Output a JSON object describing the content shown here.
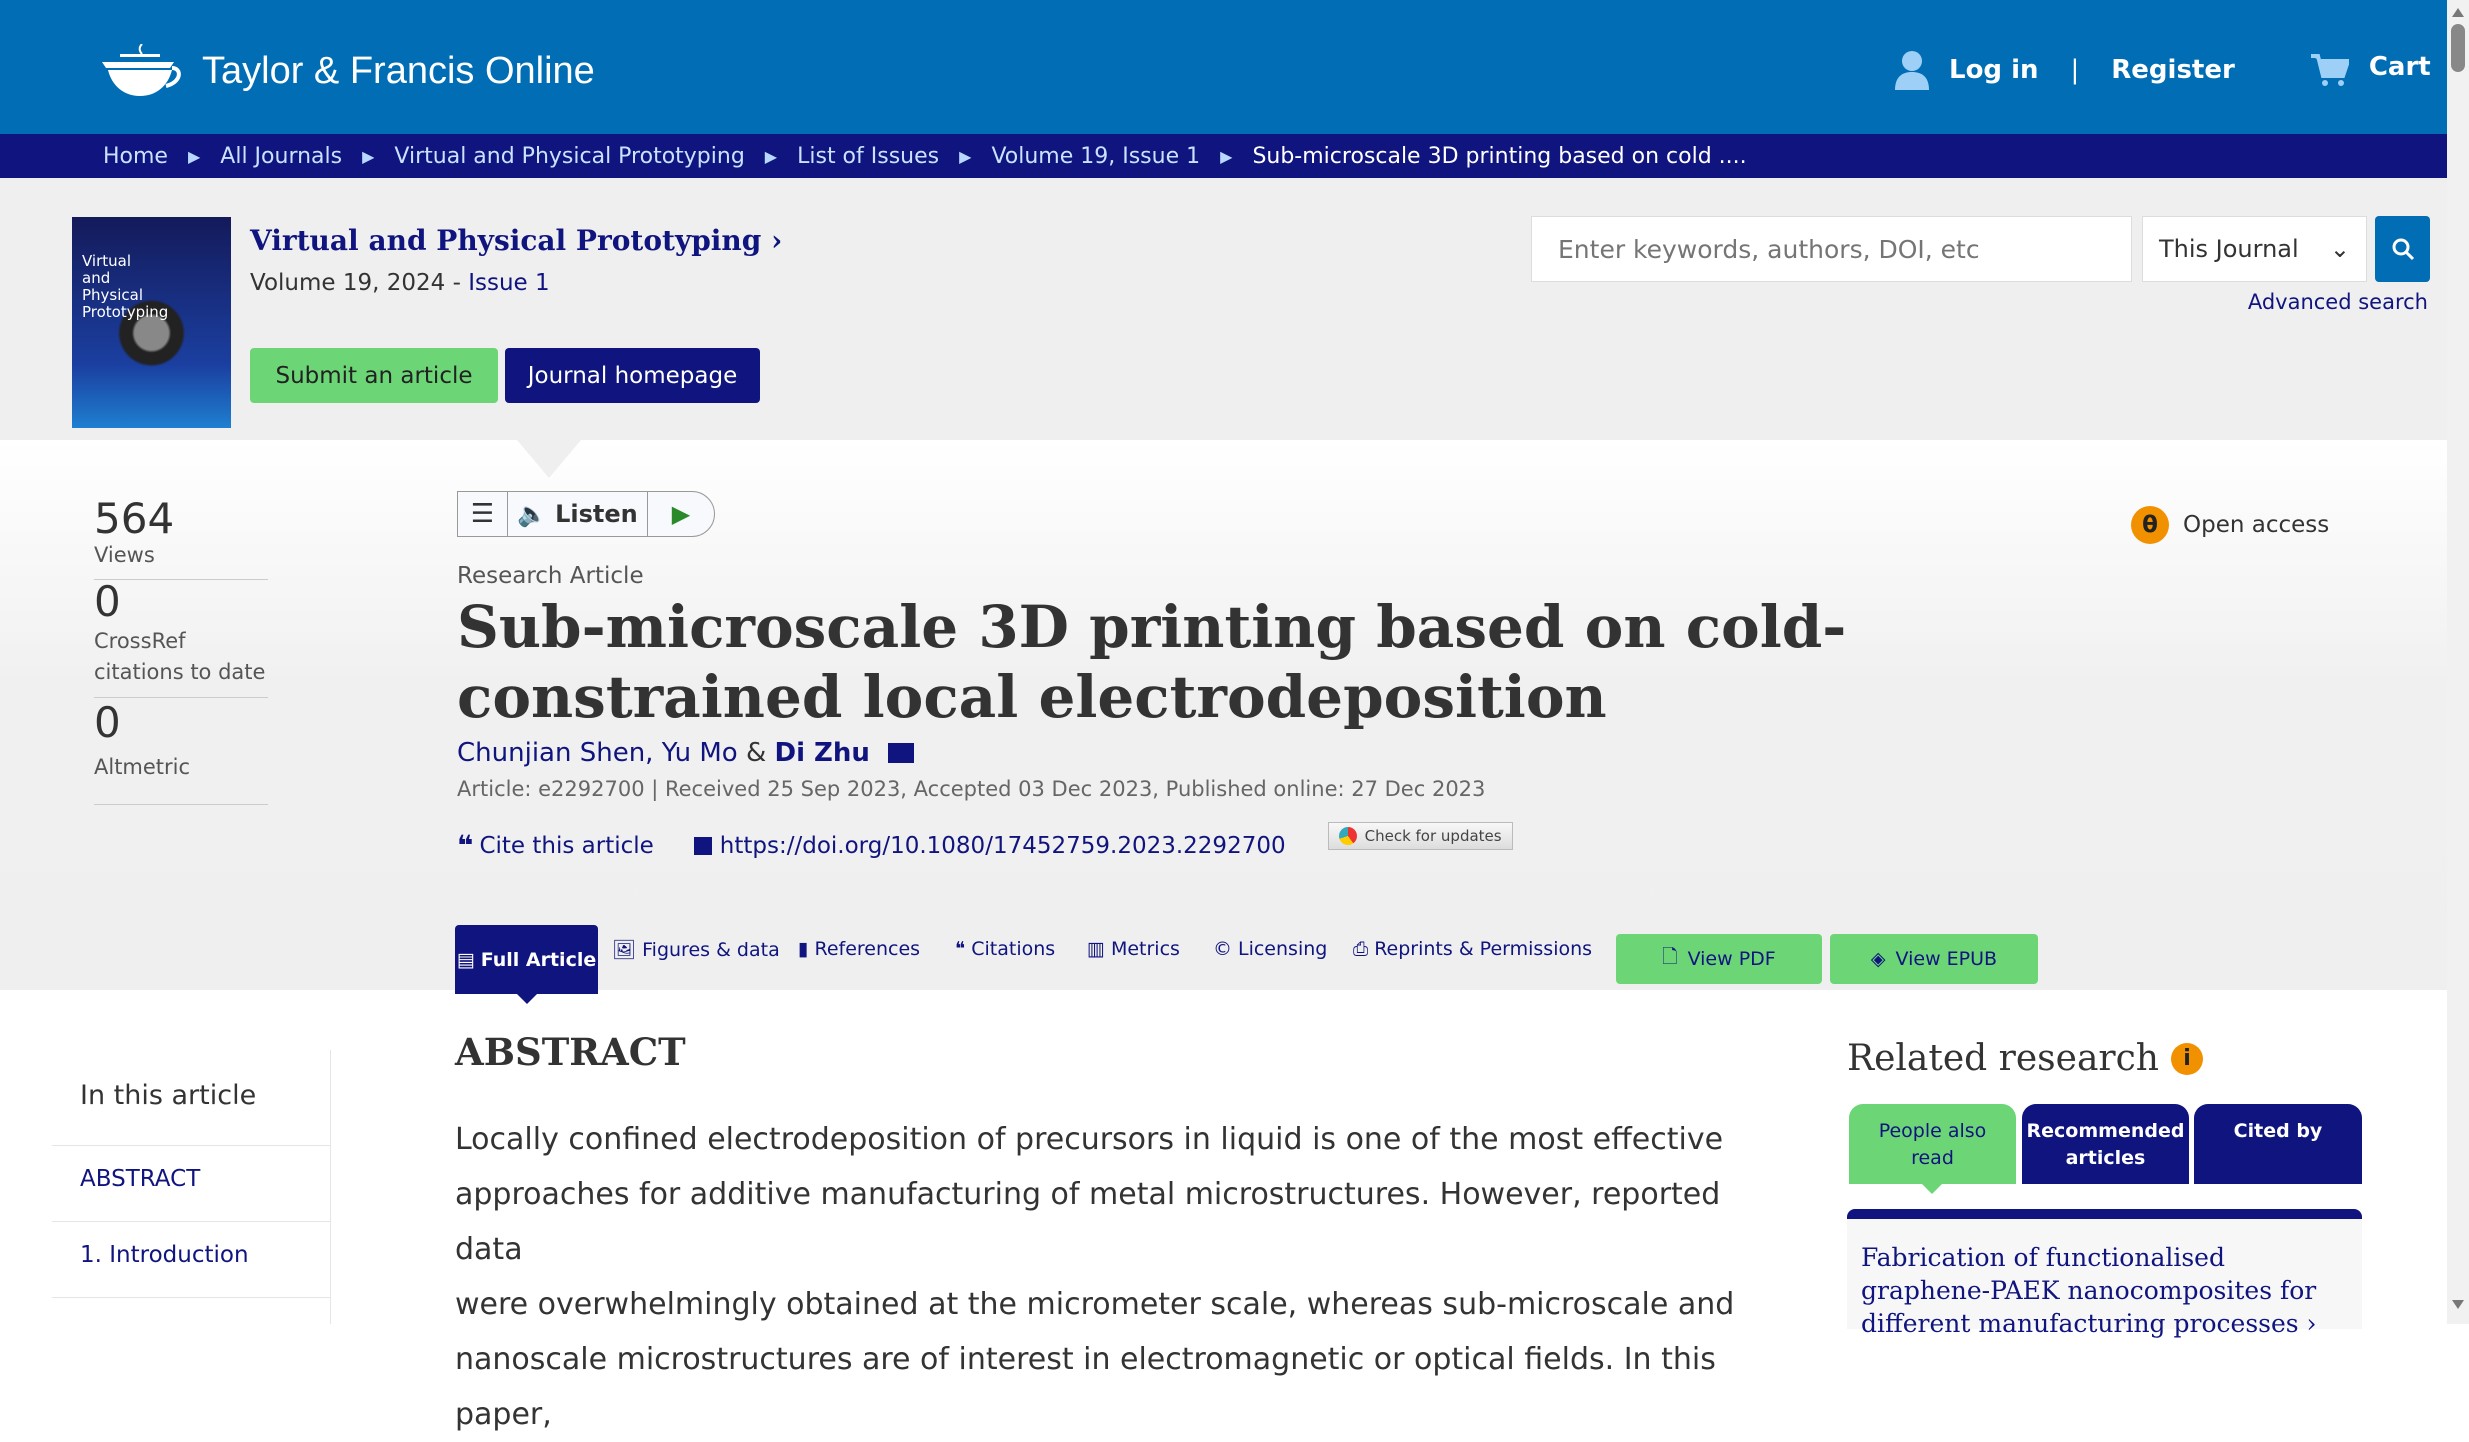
{
  "header": {
    "logo": "Taylor & Francis Online",
    "login": "Log in",
    "register": "Register",
    "cart": "Cart"
  },
  "breadcrumb": [
    "Home",
    "All Journals",
    "Virtual and Physical Prototyping",
    "List of Issues",
    "Volume 19, Issue 1",
    "Sub-microscale 3D printing based on cold ...."
  ],
  "journal": {
    "cover_text": "Virtual and Physical Prototyping",
    "title": "Virtual and Physical Prototyping",
    "volume": "Volume 19, 2024 - ",
    "issue": "Issue 1",
    "submit": "Submit an article",
    "homepage": "Journal homepage"
  },
  "search": {
    "placeholder": "Enter keywords, authors, DOI, etc",
    "scope": "This Journal",
    "advanced": "Advanced search"
  },
  "metrics": [
    {
      "value": "564",
      "label": "Views"
    },
    {
      "value": "0",
      "label": "CrossRef citations to date"
    },
    {
      "value": "0",
      "label": "Altmetric"
    }
  ],
  "listen": {
    "label": "Listen"
  },
  "open_access": "Open access",
  "article": {
    "type": "Research Article",
    "title": "Sub-microscale 3D printing based on cold-constrained local electrodeposition",
    "authors": [
      "Chunjian Shen",
      ", ",
      "Yu Mo",
      " & ",
      "Di Zhu"
    ],
    "meta": "Article: e2292700 | Received 25 Sep 2023, Accepted 03 Dec 2023, Published online: 27 Dec 2023",
    "cite": "Cite this article",
    "doi": "https://doi.org/10.1080/17452759.2023.2292700",
    "check_updates": "Check for updates"
  },
  "tabs": [
    "Full Article",
    "Figures & data",
    "References",
    "Citations",
    "Metrics",
    "Licensing",
    "Reprints & Permissions"
  ],
  "view_pdf": "View PDF",
  "view_epub": "View EPUB",
  "toc": {
    "title": "In this article",
    "items": [
      "ABSTRACT",
      "1. Introduction"
    ]
  },
  "abstract": {
    "heading": "ABSTRACT",
    "lines": [
      "Locally confined electrodeposition of precursors in liquid is one of the most effective",
      "approaches for additive manufacturing of metal microstructures. However, reported data",
      "were overwhelmingly obtained at the micrometer scale, whereas sub-microscale and",
      "nanoscale microstructures are of interest in electromagnetic or optical fields. In this paper,"
    ]
  },
  "related": {
    "title": "Related research",
    "tabs": [
      "People also read",
      "Recommended articles",
      "Cited by"
    ],
    "first_item": "Fabrication of functionalised graphene-PAEK nanocomposites for different manufacturing processes"
  },
  "colors": {
    "header": "#006db4",
    "nav": "#10147e",
    "green": "#6cd677",
    "orange": "#f29100"
  }
}
